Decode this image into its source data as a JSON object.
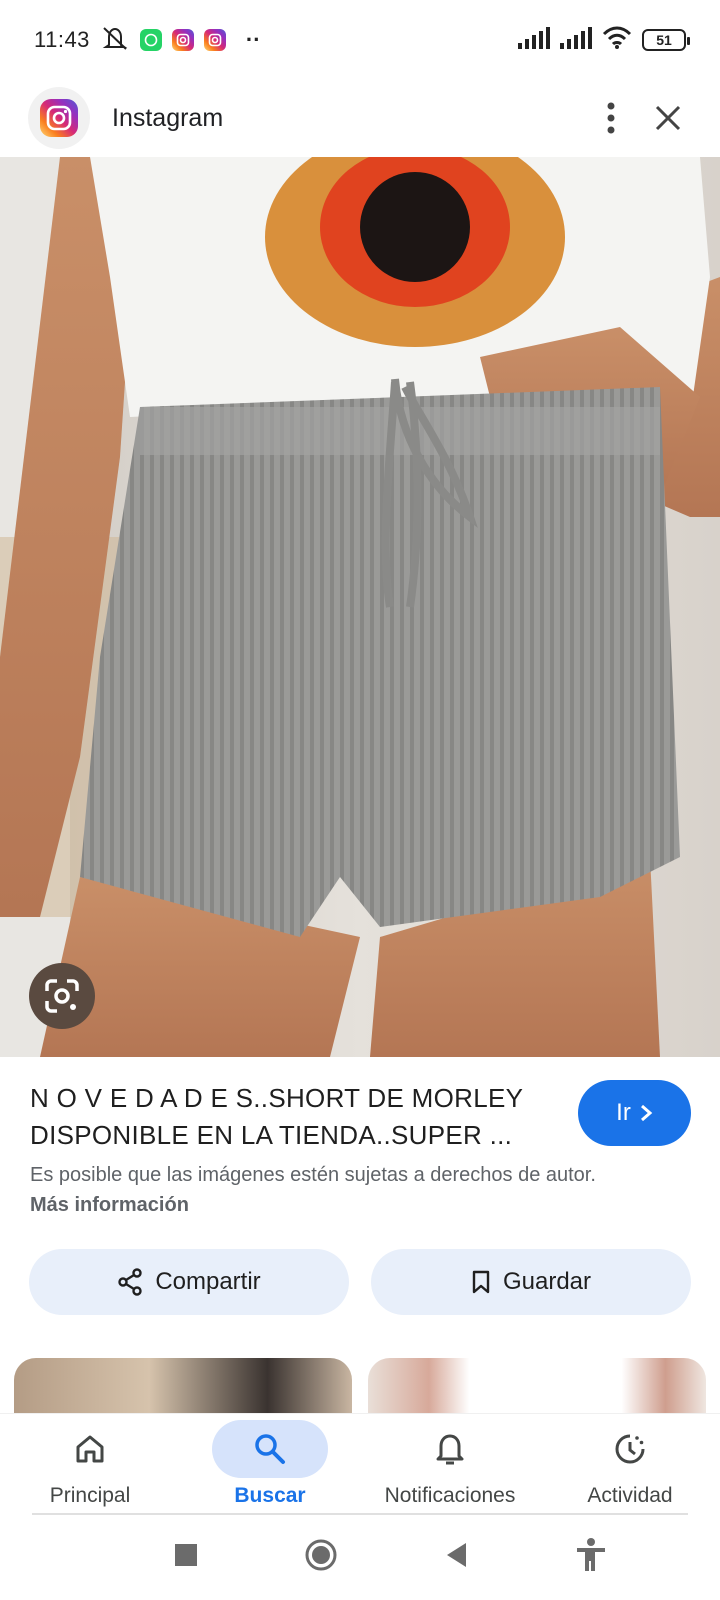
{
  "status_bar": {
    "time": "11:43",
    "overflow_dots": "··",
    "battery": "51"
  },
  "header": {
    "app_name": "Instagram"
  },
  "result": {
    "title": "N O V E D A D E S..SHORT DE MORLEY DISPONIBLE EN LA TIENDA..SUPER ...",
    "go_label": "Ir",
    "copyright_text": "Es posible que las imágenes estén sujetas a derechos de autor.",
    "more_info": "Más información"
  },
  "actions": {
    "share_label": "Compartir",
    "save_label": "Guardar"
  },
  "bottom_nav": {
    "items": [
      {
        "label": "Principal",
        "icon": "home-icon"
      },
      {
        "label": "Buscar",
        "icon": "search-icon",
        "active": true
      },
      {
        "label": "Notificaciones",
        "icon": "bell-icon"
      },
      {
        "label": "Actividad",
        "icon": "activity-icon"
      }
    ]
  },
  "colors": {
    "accent": "#1a73e8",
    "pill_bg": "#e8effa",
    "active_nav_bg": "#d6e3fb"
  }
}
